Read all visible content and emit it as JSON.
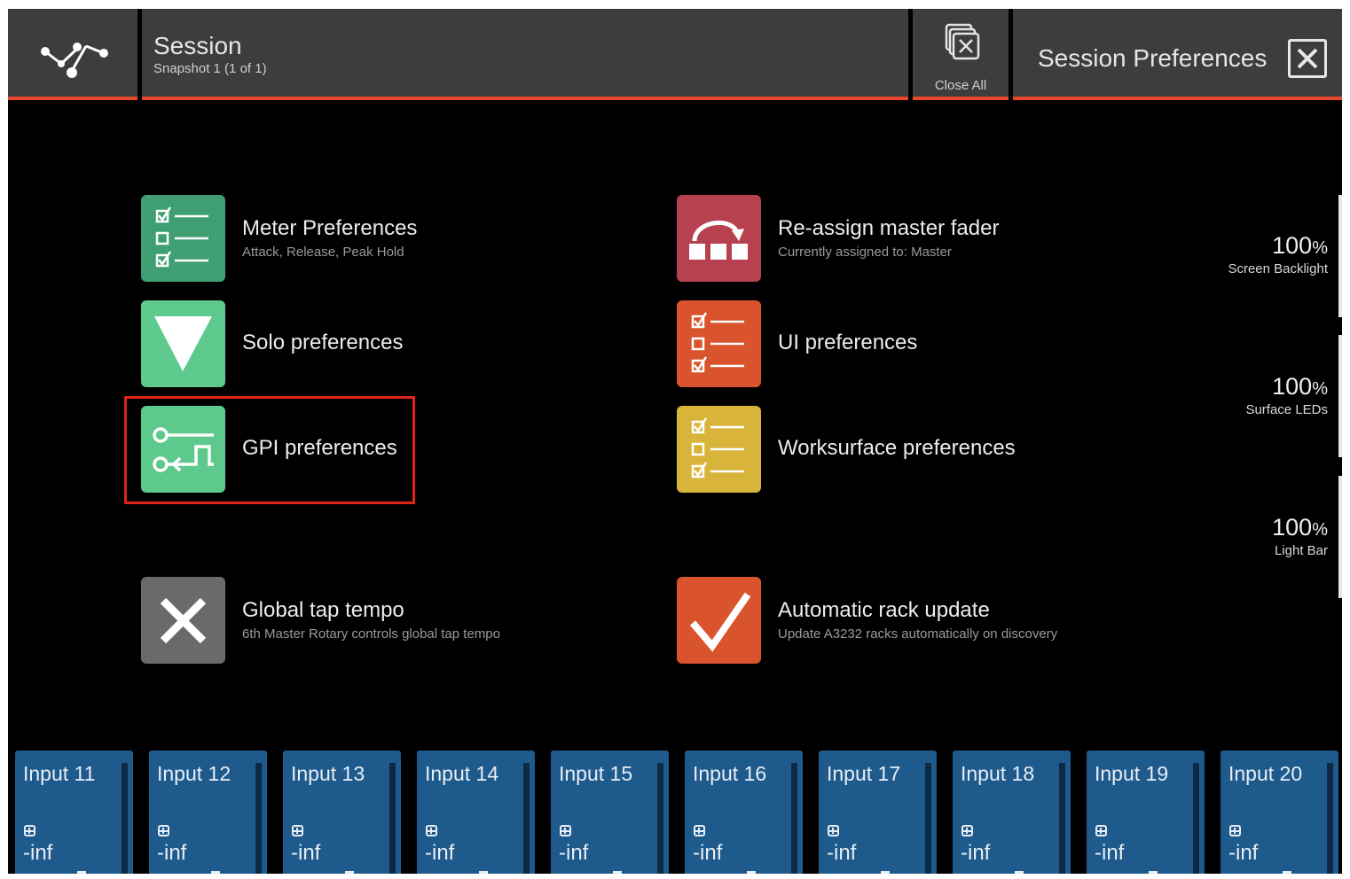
{
  "header": {
    "session_title": "Session",
    "session_subtitle": "Snapshot 1 (1 of 1)",
    "close_all_label": "Close All",
    "panel_title": "Session Preferences"
  },
  "preferences": {
    "left": [
      {
        "title": "Meter Preferences",
        "subtitle": "Attack, Release, Peak Hold",
        "icon": "checklist-icon",
        "color": "#3f9e72"
      },
      {
        "title": "Solo preferences",
        "subtitle": "",
        "icon": "triangle-down-icon",
        "color": "#5ec98c"
      },
      {
        "title": "GPI preferences",
        "subtitle": "",
        "icon": "gpi-icon",
        "color": "#5ec98c"
      },
      {
        "title": "Global tap tempo",
        "subtitle": "6th Master Rotary controls global tap tempo",
        "icon": "cross-icon",
        "color": "#6a6a6a"
      }
    ],
    "right": [
      {
        "title": "Re-assign master fader",
        "subtitle": "Currently assigned to: Master",
        "icon": "reassign-fader-icon",
        "color": "#b8414f"
      },
      {
        "title": "UI preferences",
        "subtitle": "",
        "icon": "checklist-icon",
        "color": "#d9532c"
      },
      {
        "title": "Worksurface preferences",
        "subtitle": "",
        "icon": "checklist-icon",
        "color": "#d9b43a"
      },
      {
        "title": "Automatic rack update",
        "subtitle": "Update A3232 racks automatically on discovery",
        "icon": "checkmark-icon",
        "color": "#d9532c"
      }
    ]
  },
  "levels": [
    {
      "value": "100",
      "unit": "%",
      "label": "Screen Backlight"
    },
    {
      "value": "100",
      "unit": "%",
      "label": "Surface LEDs"
    },
    {
      "value": "100",
      "unit": "%",
      "label": "Light Bar"
    }
  ],
  "strips": [
    {
      "name": "Input 11",
      "value": "-inf"
    },
    {
      "name": "Input 12",
      "value": "-inf"
    },
    {
      "name": "Input 13",
      "value": "-inf"
    },
    {
      "name": "Input 14",
      "value": "-inf"
    },
    {
      "name": "Input 15",
      "value": "-inf"
    },
    {
      "name": "Input 16",
      "value": "-inf"
    },
    {
      "name": "Input 17",
      "value": "-inf"
    },
    {
      "name": "Input 18",
      "value": "-inf"
    },
    {
      "name": "Input 19",
      "value": "-inf"
    },
    {
      "name": "Input 20",
      "value": "-inf"
    }
  ],
  "colors": {
    "accent": "#e8472b",
    "header_bg": "#3d3d3d",
    "strip_bg": "#1e5a8c",
    "highlight": "#e02418"
  }
}
